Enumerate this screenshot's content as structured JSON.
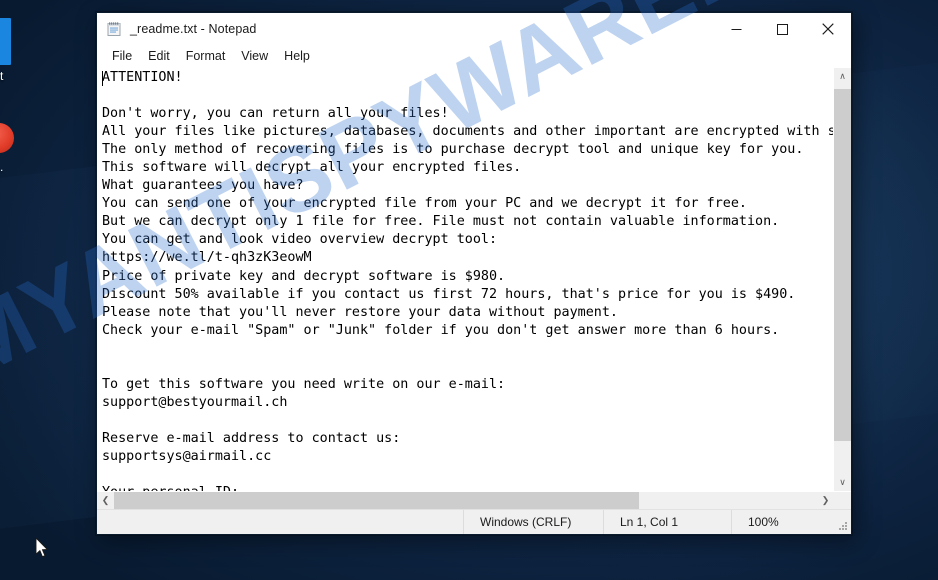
{
  "window": {
    "title": "_readme.txt - Notepad",
    "icon": "notepad-icon",
    "controls": {
      "minimize": "─",
      "maximize": "☐",
      "close": "✕"
    }
  },
  "menu": {
    "items": [
      {
        "label": "File"
      },
      {
        "label": "Edit"
      },
      {
        "label": "Format"
      },
      {
        "label": "View"
      },
      {
        "label": "Help"
      }
    ]
  },
  "editor": {
    "lines": [
      "ATTENTION!",
      "",
      "Don't worry, you can return all your files!",
      "All your files like pictures, databases, documents and other important are encrypted with s",
      "The only method of recovering files is to purchase decrypt tool and unique key for you.",
      "This software will decrypt all your encrypted files.",
      "What guarantees you have?",
      "You can send one of your encrypted file from your PC and we decrypt it for free.",
      "But we can decrypt only 1 file for free. File must not contain valuable information.",
      "You can get and look video overview decrypt tool:",
      "https://we.tl/t-qh3zK3eowM",
      "Price of private key and decrypt software is $980.",
      "Discount 50% available if you contact us first 72 hours, that's price for you is $490.",
      "Please note that you'll never restore your data without payment.",
      "Check your e-mail \"Spam\" or \"Junk\" folder if you don't get answer more than 6 hours.",
      "",
      "",
      "To get this software you need write on our e-mail:",
      "support@bestyourmail.ch",
      "",
      "Reserve e-mail address to contact us:",
      "supportsys@airmail.cc",
      "",
      "Your personal ID:"
    ],
    "ransom_note": {
      "heading": "ATTENTION!",
      "video_url": "https://we.tl/t-qh3zK3eowM",
      "price_full": "$980",
      "price_discounted": "$490",
      "discount_percent": "50%",
      "discount_window_hours": "72 hours",
      "response_time": "6 hours",
      "free_decrypt_files": "1 file",
      "primary_email": "support@bestyourmail.ch",
      "reserve_email": "supportsys@airmail.cc"
    }
  },
  "scrollbars": {
    "vertical": {
      "up_arrow": "∧",
      "down_arrow": "∨"
    },
    "horizontal": {
      "left_arrow": "❮",
      "right_arrow": "❯"
    }
  },
  "status_bar": {
    "line_ending": "Windows (CRLF)",
    "cursor_position": "Ln 1, Col 1",
    "zoom": "100%"
  },
  "desktop": {
    "icon_label_1": "t",
    "icon_label_2": "."
  },
  "watermark": {
    "text": "MYANTISPYWARE.COM"
  },
  "colors": {
    "desktop_blue": "#0d2340",
    "accent_blue": "#1a86e0",
    "close_red": "#e81123",
    "watermark_blue": "#286ecd",
    "scrollbar_thumb": "#cdcdcd"
  }
}
